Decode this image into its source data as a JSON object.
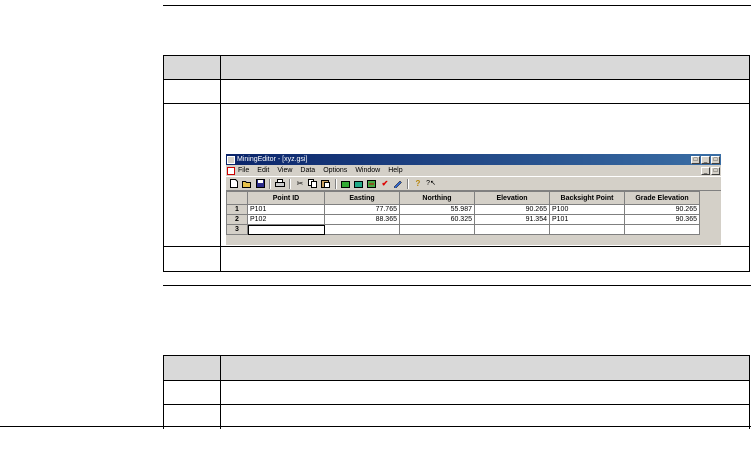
{
  "app": {
    "title": "MiningEditor - [xyz.gsi]",
    "menu": [
      "File",
      "Edit",
      "View",
      "Data",
      "Options",
      "Window",
      "Help"
    ],
    "window_buttons": [
      "_",
      "□",
      "×"
    ],
    "toolbar_icons": [
      "new-icon",
      "open-icon",
      "save-icon",
      "print-icon",
      "cut-icon",
      "copy-icon",
      "paste-icon",
      "import-icon",
      "export-icon",
      "convert-icon",
      "check-icon",
      "edit-icon",
      "help-icon",
      "context-help-icon"
    ],
    "grid": {
      "columns": [
        "Point ID",
        "Easting",
        "Northing",
        "Elevation",
        "Backsight Point",
        "Grade Elevation"
      ],
      "rows": [
        {
          "n": "1",
          "point_id": "P101",
          "easting": "77.765",
          "northing": "55.987",
          "elevation": "90.265",
          "backsight": "P100",
          "grade": "90.265"
        },
        {
          "n": "2",
          "point_id": "P102",
          "easting": "88.365",
          "northing": "60.325",
          "elevation": "91.354",
          "backsight": "P101",
          "grade": "90.365"
        },
        {
          "n": "3",
          "point_id": "",
          "easting": "",
          "northing": "",
          "elevation": "",
          "backsight": "",
          "grade": ""
        }
      ]
    }
  }
}
